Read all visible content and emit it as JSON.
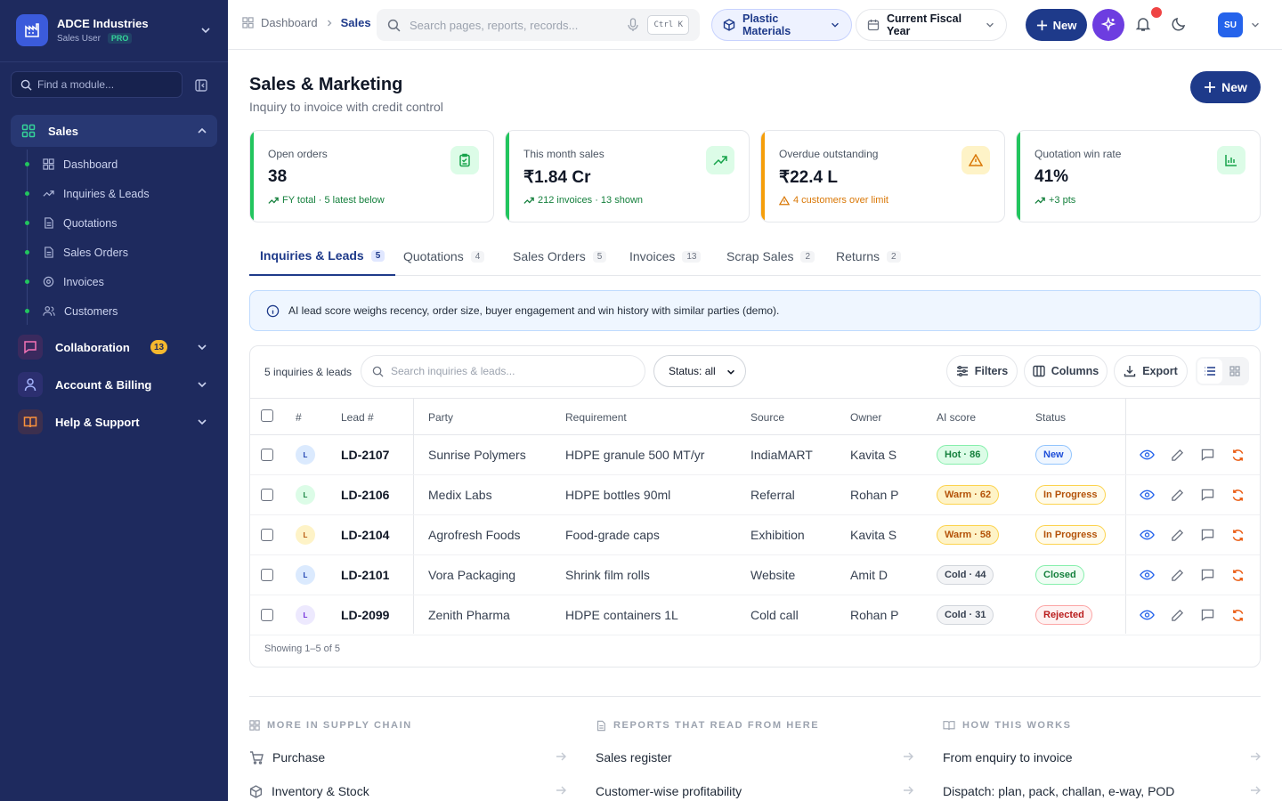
{
  "brand": {
    "name": "ADCE Industries",
    "role": "Sales User",
    "plan": "PRO"
  },
  "sidebar": {
    "find_placeholder": "Find a module...",
    "active_group": "Sales",
    "sub_items": [
      {
        "label": "Dashboard",
        "icon": "grid-icon"
      },
      {
        "label": "Inquiries & Leads",
        "icon": "trend-icon"
      },
      {
        "label": "Quotations",
        "icon": "doc-icon"
      },
      {
        "label": "Sales Orders",
        "icon": "doc-icon"
      },
      {
        "label": "Invoices",
        "icon": "coin-icon"
      },
      {
        "label": "Customers",
        "icon": "users-icon"
      }
    ],
    "groups": [
      {
        "label": "Collaboration",
        "badge": "13"
      },
      {
        "label": "Account & Billing"
      },
      {
        "label": "Help & Support"
      }
    ]
  },
  "topbar": {
    "breadcrumb": [
      "Dashboard",
      "Sales"
    ],
    "search_placeholder": "Search pages, reports, records...",
    "shortcut": "Ctrl K",
    "division": "Plastic Materials",
    "period": "Current Fiscal Year",
    "new_label": "New",
    "avatar": "SU"
  },
  "page": {
    "title": "Sales & Marketing",
    "subtitle": "Inquiry to invoice with credit control",
    "new_label": "New"
  },
  "kpis": [
    {
      "label": "Open orders",
      "value": "38",
      "foot": "FY total · 5 latest below",
      "color": "#22c55e"
    },
    {
      "label": "This month sales",
      "value": "₹1.84 Cr",
      "foot": "212 invoices · 13 shown",
      "color": "#22c55e"
    },
    {
      "label": "Overdue outstanding",
      "value": "₹22.4 L",
      "foot": "4 customers over limit",
      "color": "#f59e0b"
    },
    {
      "label": "Quotation win rate",
      "value": "41%",
      "foot": "+3 pts",
      "color": "#22c55e"
    }
  ],
  "tabs": [
    {
      "label": "Inquiries & Leads",
      "count": "5"
    },
    {
      "label": "Quotations",
      "count": "4"
    },
    {
      "label": "Sales Orders",
      "count": "5"
    },
    {
      "label": "Invoices",
      "count": "13"
    },
    {
      "label": "Scrap Sales",
      "count": "2"
    },
    {
      "label": "Returns",
      "count": "2"
    }
  ],
  "info_banner": "AI lead score weighs recency, order size, buyer engagement and win history with similar parties (demo).",
  "table": {
    "count_label": "5 inquiries & leads",
    "search_placeholder": "Search inquiries & leads...",
    "status_filter": "Status: all",
    "filters_label": "Filters",
    "columns_label": "Columns",
    "export_label": "Export",
    "headers": {
      "num": "#",
      "lead": "Lead #",
      "party": "Party",
      "requirement": "Requirement",
      "source": "Source",
      "owner": "Owner",
      "score": "AI score",
      "status": "Status"
    },
    "rows": [
      {
        "avatar": "L",
        "lead": "LD-2107",
        "party": "Sunrise Polymers",
        "requirement": "HDPE granule 500 MT/yr",
        "source": "IndiaMART",
        "owner": "Kavita S",
        "score": "Hot · 86",
        "status": "New"
      },
      {
        "avatar": "L",
        "lead": "LD-2106",
        "party": "Medix Labs",
        "requirement": "HDPE bottles 90ml",
        "source": "Referral",
        "owner": "Rohan P",
        "score": "Warm · 62",
        "status": "In Progress"
      },
      {
        "avatar": "L",
        "lead": "LD-2104",
        "party": "Agrofresh Foods",
        "requirement": "Food-grade caps",
        "source": "Exhibition",
        "owner": "Kavita S",
        "score": "Warm · 58",
        "status": "In Progress"
      },
      {
        "avatar": "L",
        "lead": "LD-2101",
        "party": "Vora Packaging",
        "requirement": "Shrink film rolls",
        "source": "Website",
        "owner": "Amit D",
        "score": "Cold · 44",
        "status": "Closed"
      },
      {
        "avatar": "L",
        "lead": "LD-2099",
        "party": "Zenith Pharma",
        "requirement": "HDPE containers 1L",
        "source": "Cold call",
        "owner": "Rohan P",
        "score": "Cold · 31",
        "status": "Rejected"
      }
    ],
    "footer": "Showing 1–5 of 5"
  },
  "bottom": {
    "supply": {
      "heading": "MORE IN SUPPLY CHAIN",
      "links": [
        "Purchase",
        "Inventory & Stock"
      ]
    },
    "reports": {
      "heading": "REPORTS THAT READ FROM HERE",
      "links": [
        "Sales register",
        "Customer-wise profitability"
      ]
    },
    "how": {
      "heading": "HOW THIS WORKS",
      "links": [
        "From enquiry to invoice",
        "Dispatch: plan, pack, challan, e-way, POD"
      ]
    }
  }
}
